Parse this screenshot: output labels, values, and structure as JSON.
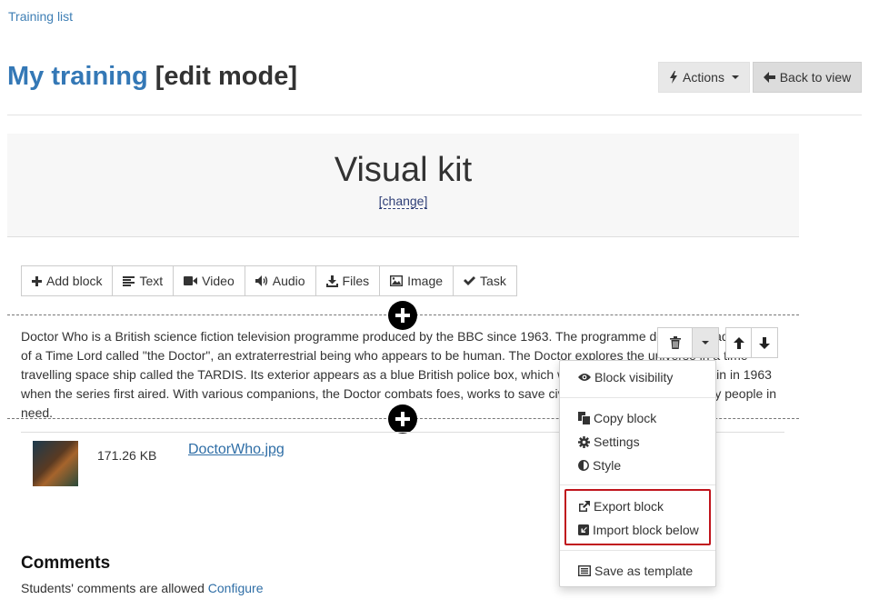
{
  "breadcrumb": {
    "label": "Training list"
  },
  "title": {
    "main": "My training",
    "mode": "[edit mode]"
  },
  "header_buttons": {
    "actions": "Actions",
    "back": "Back to view"
  },
  "kit": {
    "title": "Visual kit",
    "change": "[change]"
  },
  "toolbar": [
    {
      "label": "Add block",
      "icon": "plus-icon"
    },
    {
      "label": "Text",
      "icon": "align-left-icon"
    },
    {
      "label": "Video",
      "icon": "video-camera-icon"
    },
    {
      "label": "Audio",
      "icon": "volume-icon"
    },
    {
      "label": "Files",
      "icon": "download-icon"
    },
    {
      "label": "Image",
      "icon": "picture-icon"
    },
    {
      "label": "Task",
      "icon": "checkmark-icon"
    }
  ],
  "text_block": {
    "paragraph": "Doctor Who is a British science fiction television programme produced by the BBC since 1963. The programme depicts the adventures of a Time Lord called \"the Doctor\", an extraterrestrial being who appears to be human. The Doctor explores the universe in a time-travelling space ship called the TARDIS. Its exterior appears as a blue British police box, which was a common sight in Britain in 1963 when the series first aired. With various companions, the Doctor combats foes, works to save civilisations and helps ordinary people in need."
  },
  "file": {
    "size": "171.26 KB",
    "name": "DoctorWho.jpg"
  },
  "dropdown": {
    "items": [
      {
        "label": "Block visibility",
        "icon": "eye-icon"
      },
      {
        "label": "Copy block",
        "icon": "copy-icon"
      },
      {
        "label": "Settings",
        "icon": "gear-icon"
      },
      {
        "label": "Style",
        "icon": "adjust-icon"
      },
      {
        "label": "Export block",
        "icon": "external-link-icon"
      },
      {
        "label": "Import block below",
        "icon": "import-icon"
      },
      {
        "label": "Save as template",
        "icon": "list-alt-icon"
      }
    ]
  },
  "comments": {
    "heading": "Comments",
    "text": "Students' comments are allowed",
    "link": "Configure"
  },
  "colors": {
    "link": "#2f6ea6",
    "title": "#3478b6",
    "highlight": "#c0141c"
  }
}
